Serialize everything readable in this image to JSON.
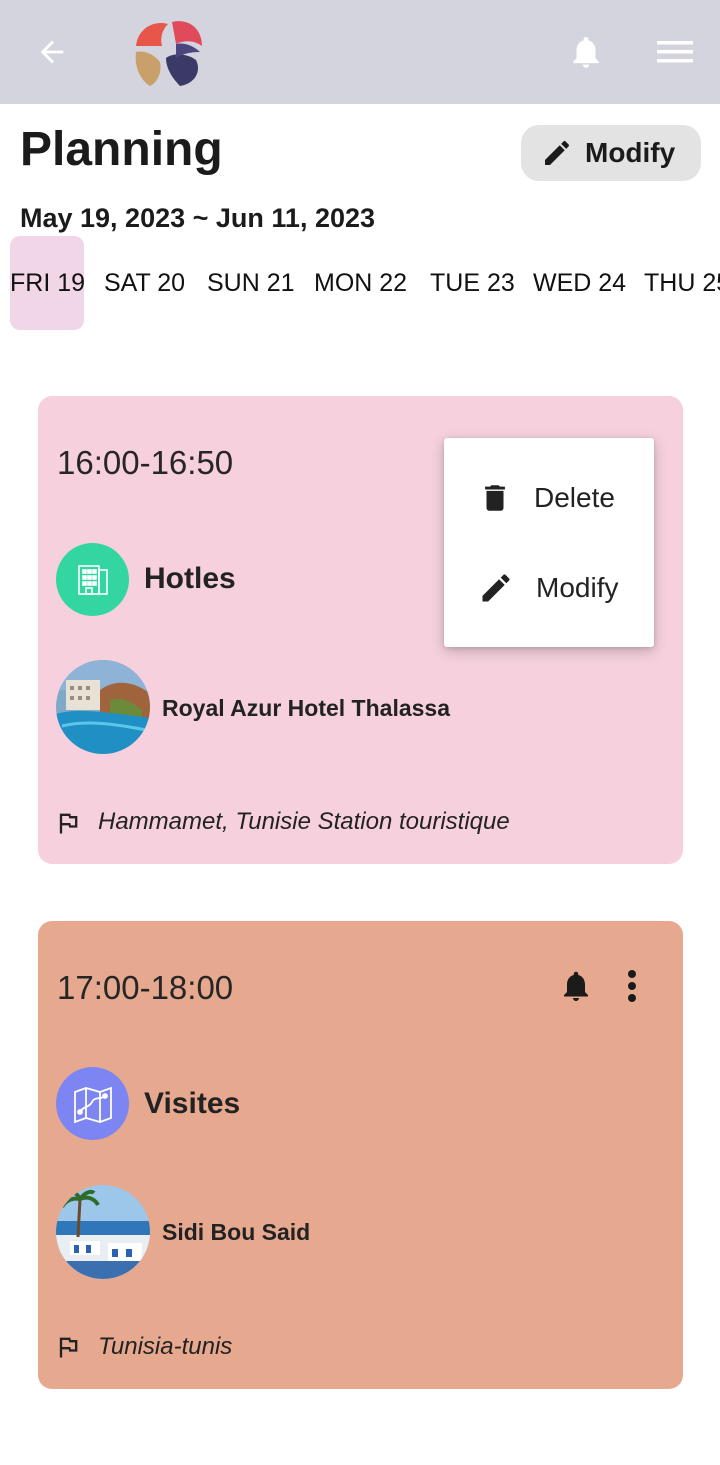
{
  "header": {
    "back_icon": "arrow-left-icon",
    "logo": "app-logo",
    "bell_icon": "bell-icon",
    "menu_icon": "hamburger-menu-icon",
    "bar_color": "#d4d4de"
  },
  "page": {
    "title": "Planning",
    "modify_label": "Modify",
    "date_range": "May 19, 2023 ~ Jun 11, 2023"
  },
  "days": [
    {
      "label": "FRI 19",
      "active": true
    },
    {
      "label": "SAT 20",
      "active": false
    },
    {
      "label": "SUN 21",
      "active": false
    },
    {
      "label": "MON 22",
      "active": false
    },
    {
      "label": "TUE 23",
      "active": false
    },
    {
      "label": "WED 24",
      "active": false
    },
    {
      "label": "THU 25",
      "active": false
    }
  ],
  "events": [
    {
      "time": "16:00-16:50",
      "category": "Hotles",
      "category_icon": "hotel-building-icon",
      "category_color": "#33d6a0",
      "place": "Royal Azur Hotel Thalassa",
      "location": "Hammamet, Tunisie Station touristique",
      "card_color": "#f6d1dd"
    },
    {
      "time": "17:00-18:00",
      "category": "Visites",
      "category_icon": "map-icon",
      "category_color": "#7d85f2",
      "place": "Sidi Bou Said",
      "location": "Tunisia-tunis",
      "card_color": "#e6a98f"
    }
  ],
  "popup_menu": {
    "delete_label": "Delete",
    "modify_label": "Modify"
  }
}
